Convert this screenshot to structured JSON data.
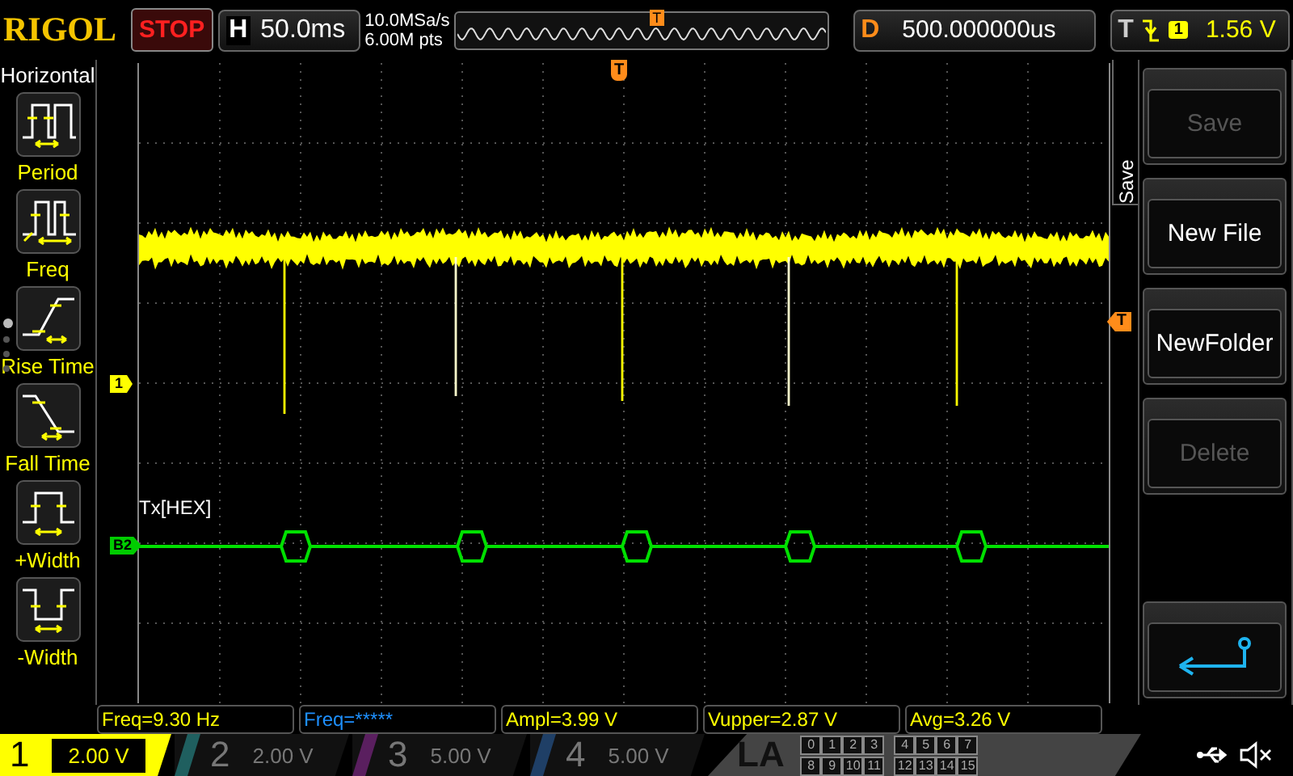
{
  "header": {
    "brand": "RIGOL",
    "run_state": "STOP",
    "timebase": {
      "label": "H",
      "value": "50.0ms"
    },
    "sample_rate": "10.0MSa/s",
    "memory_depth": "6.00M pts",
    "memory_trigger_marker": "T",
    "delay": {
      "label": "D",
      "value": "500.000000us"
    },
    "trigger": {
      "label": "T",
      "source": "1",
      "level": "1.56 V"
    }
  },
  "left_menu": {
    "title": "Horizontal",
    "items": [
      {
        "kind": "period",
        "label": "Period"
      },
      {
        "kind": "freq",
        "label": "Freq"
      },
      {
        "kind": "rise",
        "label": "Rise Time"
      },
      {
        "kind": "fall",
        "label": "Fall Time"
      },
      {
        "kind": "pwidth",
        "label": "+Width"
      },
      {
        "kind": "nwidth",
        "label": "-Width"
      }
    ],
    "pages": [
      {
        "selected": true
      },
      {
        "selected": false
      },
      {
        "selected": false
      },
      {
        "selected": false
      }
    ]
  },
  "plot": {
    "trigger_position_marker": "T",
    "trigger_level_marker": "T",
    "channel_marker": "1",
    "decode_label": "Tx[HEX]",
    "bus_marker": "B2"
  },
  "right_menu": {
    "title": "Save",
    "items": [
      {
        "kind": "text",
        "label": "Save",
        "disabled": true
      },
      {
        "kind": "text",
        "label": "New File",
        "disabled": false
      },
      {
        "kind": "text",
        "label": "NewFolder",
        "disabled": false
      },
      {
        "kind": "text",
        "label": "Delete",
        "disabled": true
      },
      {
        "kind": "spacer"
      },
      {
        "kind": "back"
      }
    ]
  },
  "measurements": [
    {
      "text": "Freq=9.30 Hz",
      "color": "#ffff00"
    },
    {
      "text": "Freq=*****",
      "color": "#1e90ff"
    },
    {
      "text": "Ampl=3.99 V",
      "color": "#ffff00"
    },
    {
      "text": "Vupper=2.87 V",
      "color": "#ffff00"
    },
    {
      "text": "Avg=3.26 V",
      "color": "#ffff00"
    }
  ],
  "channels": [
    {
      "number": "1",
      "scale": "2.00 V",
      "active": true,
      "color": "#ffff00"
    },
    {
      "number": "2",
      "scale": "2.00 V",
      "active": false,
      "color": "#1f5f5f"
    },
    {
      "number": "3",
      "scale": "5.00 V",
      "active": false,
      "color": "#5a1f5f"
    },
    {
      "number": "4",
      "scale": "5.00 V",
      "active": false,
      "color": "#1f3f66"
    }
  ],
  "logic_analyzer": {
    "label": "LA",
    "bits": [
      "0",
      "1",
      "2",
      "3",
      "4",
      "5",
      "6",
      "7",
      "8",
      "9",
      "10",
      "11",
      "12",
      "13",
      "14",
      "15"
    ]
  }
}
